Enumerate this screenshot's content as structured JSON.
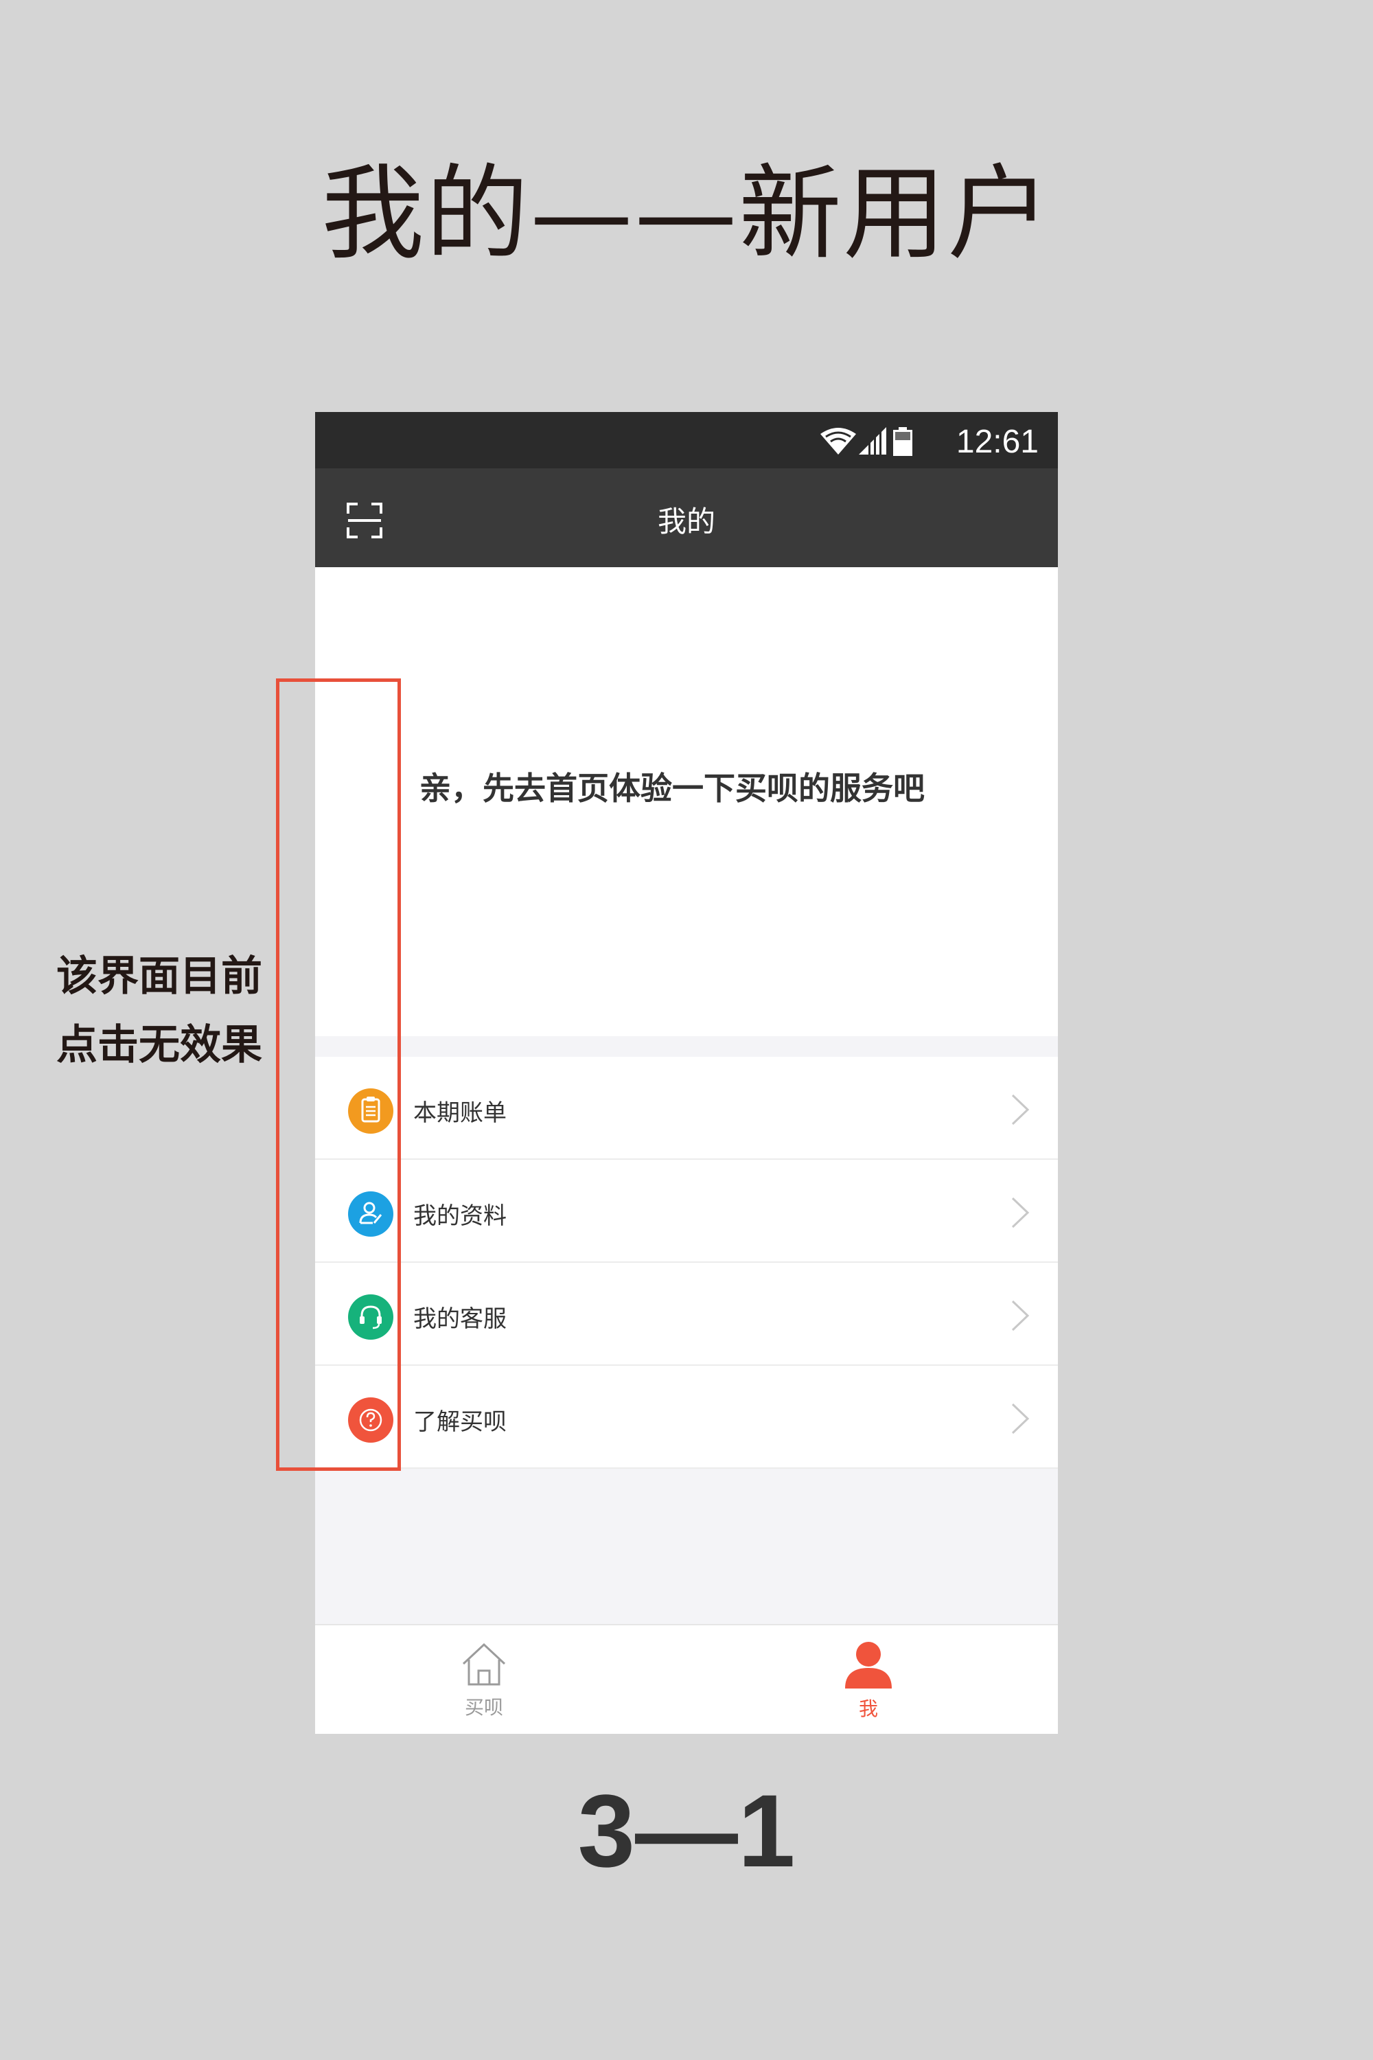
{
  "header": {
    "title": "我的——新用户"
  },
  "annotation": {
    "lines": [
      "该界面目前",
      "点击无效果"
    ],
    "box_color": "#e8503a"
  },
  "footer": {
    "label": "3—1"
  },
  "phone": {
    "status_bar": {
      "time": "12:61",
      "icons": [
        "wifi-icon",
        "signal-icon",
        "battery-icon"
      ]
    },
    "app_bar": {
      "title": "我的",
      "left_icon": "scan-icon"
    },
    "hero": {
      "message": "亲，先去首页体验一下买呗的服务吧"
    },
    "menu": [
      {
        "label": "本期账单",
        "icon": "clipboard-icon",
        "color": "#f29a1f"
      },
      {
        "label": "我的资料",
        "icon": "profile-edit-icon",
        "color": "#1ca1e2"
      },
      {
        "label": "我的客服",
        "icon": "headset-icon",
        "color": "#16b27b"
      },
      {
        "label": "了解买呗",
        "icon": "question-icon",
        "color": "#f0543c"
      }
    ],
    "tab_bar": {
      "tabs": [
        {
          "label": "买呗",
          "icon": "home-icon",
          "active": false
        },
        {
          "label": "我",
          "icon": "person-icon",
          "active": true
        }
      ],
      "active_color": "#f0543c",
      "inactive_color": "#9b9b9b"
    }
  }
}
